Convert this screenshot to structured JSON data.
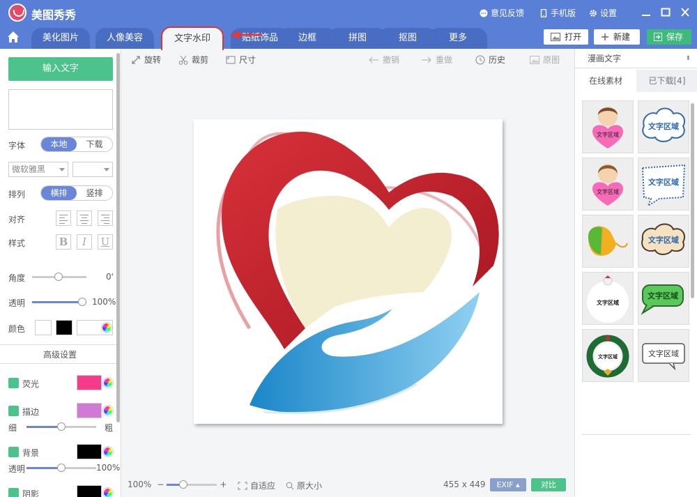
{
  "app": {
    "title": "美图秀秀"
  },
  "titlebar": {
    "feedback": "意见反馈",
    "mobile": "手机版",
    "settings": "设置"
  },
  "tabs": [
    "美化图片",
    "人像美容",
    "文字水印",
    "贴纸饰品",
    "边框",
    "拼图",
    "抠图",
    "更多"
  ],
  "header": {
    "open": "打开",
    "new": "新建",
    "save": "保存"
  },
  "left": {
    "input_button": "输入文字",
    "font_label": "字体",
    "font_local": "本地",
    "font_download": "下载",
    "font_name": "微软雅黑",
    "arrange_label": "排列",
    "arrange_horizontal": "横排",
    "arrange_vertical": "竖排",
    "align_label": "对齐",
    "style_label": "样式",
    "style_bold": "B",
    "style_italic": "I",
    "style_underline": "U",
    "angle_label": "角度",
    "angle_value": "0'",
    "opacity_label": "透明",
    "opacity_value": "100%",
    "color_label": "颜色",
    "advanced": "高级设置",
    "glow_label": "荧光",
    "stroke_label": "描边",
    "thin": "细",
    "thick": "粗",
    "bg_label": "背景",
    "bg_opacity_label": "透明",
    "bg_opacity_value": "100%",
    "shadow_label": "阴影"
  },
  "toolbar": {
    "rotate": "旋转",
    "crop": "裁剪",
    "size": "尺寸",
    "undo": "撤销",
    "redo": "重做",
    "history": "历史",
    "original": "原图"
  },
  "bottom": {
    "zoom": "100%",
    "fit": "自适应",
    "actual": "原大小",
    "dimensions": "455 x 449",
    "exif": "EXIF",
    "compare": "对比"
  },
  "right": {
    "category": "漫画文字",
    "tab_online": "在线素材",
    "tab_downloaded": "已下载[4]",
    "sticker_text": "文字区域"
  },
  "colors": {
    "accent": "#5a7fd6",
    "green": "#4cc38a",
    "glow": "#f53c8c",
    "stroke": "#d07ad6",
    "highlight": "#d23a3a"
  }
}
